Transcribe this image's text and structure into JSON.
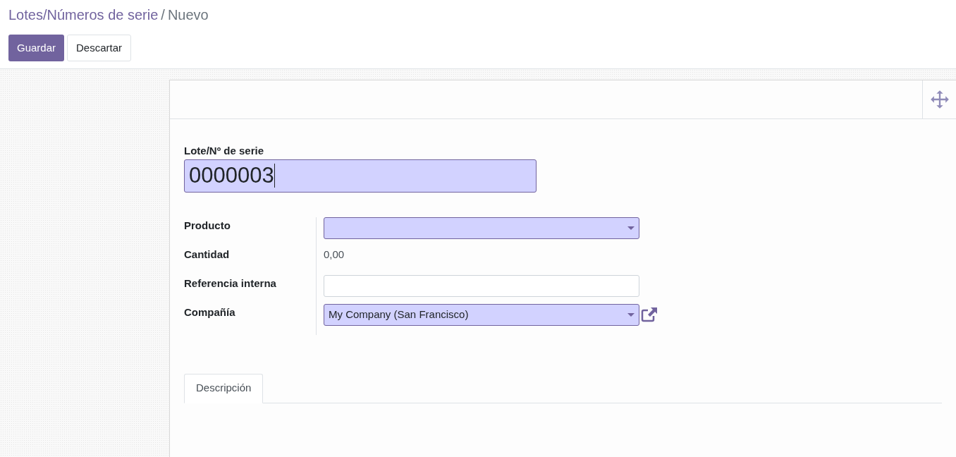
{
  "breadcrumb": {
    "parent": "Lotes/Números de serie",
    "separator": "/",
    "current": "Nuevo"
  },
  "buttons": [
    {
      "label": "Guardar",
      "kind": "primary"
    },
    {
      "label": "Descartar",
      "kind": "secondary"
    }
  ],
  "lot_field": {
    "label": "Lote/Nº de serie",
    "value": "0000003",
    "required": true
  },
  "fields": [
    {
      "label": "Producto",
      "kind": "select",
      "required": true
    },
    {
      "label": "Cantidad",
      "kind": "readonly",
      "value": "0,00"
    },
    {
      "label": "Referencia interna",
      "kind": "input",
      "required": false
    },
    {
      "label": "Compañía",
      "kind": "select",
      "value": "My Company (San Francisco)",
      "required": true,
      "external_link": true
    }
  ],
  "tabs": [
    {
      "label": "Descripción",
      "selected": true
    }
  ]
}
